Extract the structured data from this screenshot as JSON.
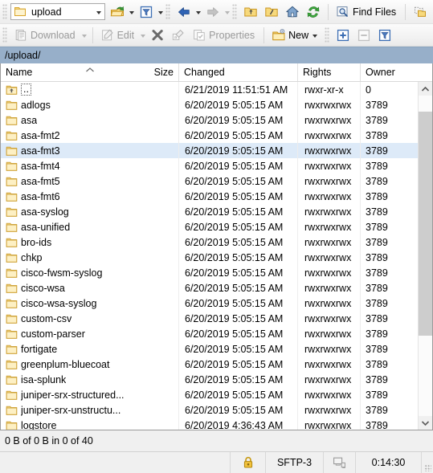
{
  "toolbar_top": {
    "path_combo": {
      "icon": "folder-icon",
      "value": "upload",
      "dropdown": "chevron-down-icon"
    },
    "open_dir_button": {
      "icon": "open-folder-icon",
      "label": ""
    },
    "open_dir_dropdown": "chevron-down-icon",
    "filter_button": {
      "icon": "filter-funnel-icon",
      "label": ""
    },
    "filter_dropdown": "chevron-down-icon",
    "back_button": {
      "icon": "back-arrow-icon",
      "label": ""
    },
    "back_dropdown": "chevron-down-icon",
    "forward_button": {
      "icon": "forward-arrow-icon",
      "label": ""
    },
    "forward_dropdown": "chevron-down-icon",
    "parent_button": {
      "icon": "parent-folder-icon"
    },
    "root_button": {
      "icon": "root-folder-icon"
    },
    "home_button": {
      "icon": "home-icon"
    },
    "refresh_button": {
      "icon": "refresh-icon"
    },
    "find_files_button": {
      "icon": "find-files-icon",
      "label": "Find Files"
    },
    "sync_browsing_button": {
      "icon": "sync-browsing-icon"
    }
  },
  "toolbar_second": {
    "download_button": {
      "icon": "download-icon",
      "label": "Download",
      "enabled": false
    },
    "download_dropdown": "chevron-down-icon",
    "edit_button": {
      "icon": "edit-icon",
      "label": "Edit",
      "enabled": false
    },
    "edit_dropdown": "chevron-down-icon",
    "delete_button": {
      "icon": "delete-x-icon",
      "enabled": false
    },
    "rename_button": {
      "icon": "rename-icon",
      "enabled": false
    },
    "properties_button": {
      "icon": "properties-icon",
      "label": "Properties",
      "enabled": false
    },
    "new_button": {
      "icon": "new-folder-icon",
      "label": "New"
    },
    "new_dropdown": "chevron-down-icon",
    "select_add_button": {
      "icon": "plus-box-icon"
    },
    "select_remove_button": {
      "icon": "minus-box-icon",
      "enabled": false
    },
    "select_filter_button": {
      "icon": "selection-funnel-icon"
    }
  },
  "path_bar": {
    "path": "/upload/"
  },
  "columns": [
    {
      "key": "name",
      "label": "Name",
      "sort": "ascending"
    },
    {
      "key": "size",
      "label": "Size"
    },
    {
      "key": "changed",
      "label": "Changed"
    },
    {
      "key": "rights",
      "label": "Rights"
    },
    {
      "key": "owner",
      "label": "Owner"
    }
  ],
  "files": [
    {
      "name": "..",
      "icon": "parent-folder-icon",
      "size": "",
      "changed": "6/21/2019 11:51:51 AM",
      "rights": "rwxr-xr-x",
      "owner": "0",
      "focused": true,
      "selected": false
    },
    {
      "name": "adlogs",
      "icon": "folder-icon",
      "size": "",
      "changed": "6/20/2019 5:05:15 AM",
      "rights": "rwxrwxrwx",
      "owner": "3789",
      "focused": false,
      "selected": false
    },
    {
      "name": "asa",
      "icon": "folder-icon",
      "size": "",
      "changed": "6/20/2019 5:05:15 AM",
      "rights": "rwxrwxrwx",
      "owner": "3789",
      "focused": false,
      "selected": false
    },
    {
      "name": "asa-fmt2",
      "icon": "folder-icon",
      "size": "",
      "changed": "6/20/2019 5:05:15 AM",
      "rights": "rwxrwxrwx",
      "owner": "3789",
      "focused": false,
      "selected": false
    },
    {
      "name": "asa-fmt3",
      "icon": "folder-icon",
      "size": "",
      "changed": "6/20/2019 5:05:15 AM",
      "rights": "rwxrwxrwx",
      "owner": "3789",
      "focused": false,
      "selected": true
    },
    {
      "name": "asa-fmt4",
      "icon": "folder-icon",
      "size": "",
      "changed": "6/20/2019 5:05:15 AM",
      "rights": "rwxrwxrwx",
      "owner": "3789",
      "focused": false,
      "selected": false
    },
    {
      "name": "asa-fmt5",
      "icon": "folder-icon",
      "size": "",
      "changed": "6/20/2019 5:05:15 AM",
      "rights": "rwxrwxrwx",
      "owner": "3789",
      "focused": false,
      "selected": false
    },
    {
      "name": "asa-fmt6",
      "icon": "folder-icon",
      "size": "",
      "changed": "6/20/2019 5:05:15 AM",
      "rights": "rwxrwxrwx",
      "owner": "3789",
      "focused": false,
      "selected": false
    },
    {
      "name": "asa-syslog",
      "icon": "folder-icon",
      "size": "",
      "changed": "6/20/2019 5:05:15 AM",
      "rights": "rwxrwxrwx",
      "owner": "3789",
      "focused": false,
      "selected": false
    },
    {
      "name": "asa-unified",
      "icon": "folder-icon",
      "size": "",
      "changed": "6/20/2019 5:05:15 AM",
      "rights": "rwxrwxrwx",
      "owner": "3789",
      "focused": false,
      "selected": false
    },
    {
      "name": "bro-ids",
      "icon": "folder-icon",
      "size": "",
      "changed": "6/20/2019 5:05:15 AM",
      "rights": "rwxrwxrwx",
      "owner": "3789",
      "focused": false,
      "selected": false
    },
    {
      "name": "chkp",
      "icon": "folder-icon",
      "size": "",
      "changed": "6/20/2019 5:05:15 AM",
      "rights": "rwxrwxrwx",
      "owner": "3789",
      "focused": false,
      "selected": false
    },
    {
      "name": "cisco-fwsm-syslog",
      "icon": "folder-icon",
      "size": "",
      "changed": "6/20/2019 5:05:15 AM",
      "rights": "rwxrwxrwx",
      "owner": "3789",
      "focused": false,
      "selected": false
    },
    {
      "name": "cisco-wsa",
      "icon": "folder-icon",
      "size": "",
      "changed": "6/20/2019 5:05:15 AM",
      "rights": "rwxrwxrwx",
      "owner": "3789",
      "focused": false,
      "selected": false
    },
    {
      "name": "cisco-wsa-syslog",
      "icon": "folder-icon",
      "size": "",
      "changed": "6/20/2019 5:05:15 AM",
      "rights": "rwxrwxrwx",
      "owner": "3789",
      "focused": false,
      "selected": false
    },
    {
      "name": "custom-csv",
      "icon": "folder-icon",
      "size": "",
      "changed": "6/20/2019 5:05:15 AM",
      "rights": "rwxrwxrwx",
      "owner": "3789",
      "focused": false,
      "selected": false
    },
    {
      "name": "custom-parser",
      "icon": "folder-icon",
      "size": "",
      "changed": "6/20/2019 5:05:15 AM",
      "rights": "rwxrwxrwx",
      "owner": "3789",
      "focused": false,
      "selected": false
    },
    {
      "name": "fortigate",
      "icon": "folder-icon",
      "size": "",
      "changed": "6/20/2019 5:05:15 AM",
      "rights": "rwxrwxrwx",
      "owner": "3789",
      "focused": false,
      "selected": false
    },
    {
      "name": "greenplum-bluecoat",
      "icon": "folder-icon",
      "size": "",
      "changed": "6/20/2019 5:05:15 AM",
      "rights": "rwxrwxrwx",
      "owner": "3789",
      "focused": false,
      "selected": false
    },
    {
      "name": "isa-splunk",
      "icon": "folder-icon",
      "size": "",
      "changed": "6/20/2019 5:05:15 AM",
      "rights": "rwxrwxrwx",
      "owner": "3789",
      "focused": false,
      "selected": false
    },
    {
      "name": "juniper-srx-structured...",
      "icon": "folder-icon",
      "size": "",
      "changed": "6/20/2019 5:05:15 AM",
      "rights": "rwxrwxrwx",
      "owner": "3789",
      "focused": false,
      "selected": false
    },
    {
      "name": "juniper-srx-unstructu...",
      "icon": "folder-icon",
      "size": "",
      "changed": "6/20/2019 5:05:15 AM",
      "rights": "rwxrwxrwx",
      "owner": "3789",
      "focused": false,
      "selected": false
    },
    {
      "name": "logstore",
      "icon": "folder-icon",
      "size": "",
      "changed": "6/20/2019 4:36:43 AM",
      "rights": "rwxrwxrwx",
      "owner": "3789",
      "focused": false,
      "selected": false
    }
  ],
  "scrollbar": {
    "up_arrow": "chevron-up-icon",
    "down_arrow": "chevron-down-icon",
    "thumb_top_pct": 5,
    "thumb_height_pct": 70
  },
  "status": {
    "selection_summary": "0 B of 0 B in 0 of 40",
    "security_icon": "lock-icon",
    "protocol": "SFTP-3",
    "session_icon": "session-icon",
    "duration": "0:14:30",
    "resize_grip": "resize-grip-icon"
  },
  "colors": {
    "path_bar_bg": "#97afc9",
    "selection_bg": "#ddeaf8",
    "folder_yellow": "#f5d97e",
    "accent_blue": "#2a5db0"
  }
}
